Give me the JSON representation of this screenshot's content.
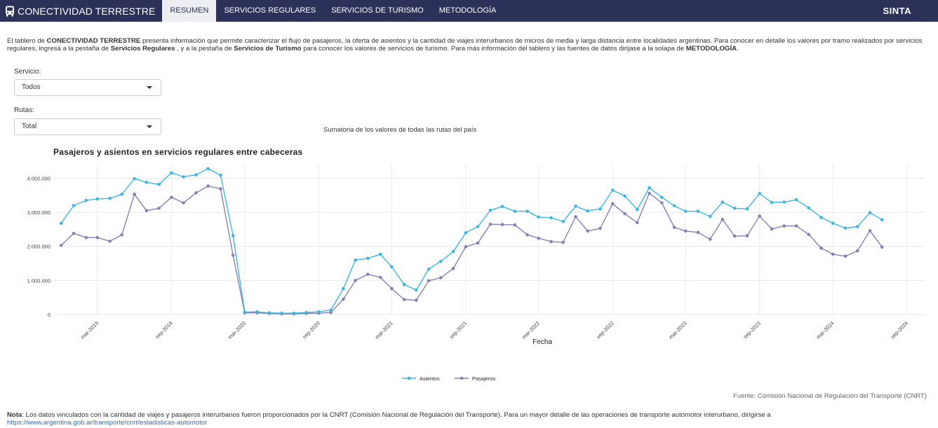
{
  "navbar": {
    "brand": "CONECTIVIDAD TERRESTRE",
    "brand_icon": "bus-icon",
    "tabs": [
      {
        "label": "RESUMEN",
        "active": true
      },
      {
        "label": "SERVICIOS REGULARES",
        "active": false
      },
      {
        "label": "SERVICIOS DE TURISMO",
        "active": false
      },
      {
        "label": "METODOLOGÍA",
        "active": false
      }
    ],
    "right_brand": "SINTA",
    "bg_color": "#2c3159"
  },
  "intro": {
    "t1": "El tablero de ",
    "b1": "CONECTIVIDAD TERRESTRE",
    "t2": " presenta información que permite caracterizar el flujo de pasajeros, la oferta de asientos y la cantidad de viajes interurbanos de micros de media y larga distancia entre localidades argentinas. Para conocer en detalle los valores por tramo realizados por servicios regulares, ingresá a la pestaña de ",
    "b2": "Servicios Regulares",
    "t3": " , y a la pestaña de ",
    "b3": "Servicios de Turismo",
    "t4": " para conocer los valores de servicios de turismo. Para más información del tablero y las fuentes de datos dirijase a la solapa de ",
    "b4": "METODOLOGÍA",
    "t5": "."
  },
  "filters": {
    "servicio_label": "Servicio:",
    "servicio_value": "Todos",
    "rutas_label": "Rutas:",
    "rutas_value": "Total"
  },
  "chart_subtitle": "Sumatoria de los valores de todas las rutas del país",
  "chart_data": {
    "type": "line",
    "title": "Pasajeros y asientos en servicios regulares entre cabeceras",
    "xlabel": "Fecha",
    "ylabel": "",
    "x": [
      "2018-12",
      "2019-01",
      "2019-02",
      "2019-03",
      "2019-04",
      "2019-05",
      "2019-06",
      "2019-07",
      "2019-08",
      "2019-09",
      "2019-10",
      "2019-11",
      "2019-12",
      "2020-01",
      "2020-02",
      "2020-03",
      "2020-04",
      "2020-05",
      "2020-06",
      "2020-07",
      "2020-08",
      "2020-09",
      "2020-10",
      "2020-11",
      "2020-12",
      "2021-01",
      "2021-02",
      "2021-03",
      "2021-04",
      "2021-05",
      "2021-06",
      "2021-07",
      "2021-08",
      "2021-09",
      "2021-10",
      "2021-11",
      "2021-12",
      "2022-01",
      "2022-02",
      "2022-03",
      "2022-04",
      "2022-05",
      "2022-06",
      "2022-07",
      "2022-08",
      "2022-09",
      "2022-10",
      "2022-11",
      "2022-12",
      "2023-01",
      "2023-02",
      "2023-03",
      "2023-04",
      "2023-05",
      "2023-06",
      "2023-07",
      "2023-08",
      "2023-09",
      "2023-10",
      "2023-11",
      "2023-12",
      "2024-01",
      "2024-02",
      "2024-03",
      "2024-04",
      "2024-05",
      "2024-06",
      "2024-07",
      "2024-08"
    ],
    "x_ticks": [
      "mar-2019",
      "sep-2019",
      "mar-2020",
      "sep-2020",
      "mar-2021",
      "sep-2021",
      "mar-2022",
      "sep-2022",
      "mar-2023",
      "sep-2023",
      "mar-2024",
      "sep-2024"
    ],
    "x_tick_dates": [
      "2019-03",
      "2019-09",
      "2020-03",
      "2020-09",
      "2021-03",
      "2021-09",
      "2022-03",
      "2022-09",
      "2023-03",
      "2023-09",
      "2024-03",
      "2024-09"
    ],
    "y_ticks": [
      "0",
      "1.000.000",
      "2.000.000",
      "3.000.000",
      "4.000.000"
    ],
    "ylim": [
      0,
      4400000
    ],
    "x_range": [
      "2018-11-15",
      "2024-10-15"
    ],
    "grid": true,
    "legend_position": "bottom-center",
    "series": [
      {
        "name": "Asientos",
        "color": "#3fb6e2",
        "values": [
          2680000,
          3200000,
          3350000,
          3390000,
          3410000,
          3530000,
          3990000,
          3880000,
          3820000,
          4160000,
          4040000,
          4100000,
          4280000,
          4090000,
          2320000,
          70000,
          80000,
          50000,
          40000,
          40000,
          60000,
          80000,
          130000,
          760000,
          1600000,
          1650000,
          1770000,
          1400000,
          880000,
          720000,
          1330000,
          1560000,
          1850000,
          2400000,
          2580000,
          3060000,
          3170000,
          3030000,
          3030000,
          2860000,
          2840000,
          2730000,
          3180000,
          3040000,
          3100000,
          3650000,
          3480000,
          3080000,
          3720000,
          3440000,
          3190000,
          3030000,
          3030000,
          2880000,
          3300000,
          3120000,
          3100000,
          3550000,
          3290000,
          3300000,
          3370000,
          3130000,
          2850000,
          2680000,
          2540000,
          2580000,
          2990000,
          2780000
        ]
      },
      {
        "name": "Pasajeros",
        "color": "#8a7fb5",
        "values": [
          2030000,
          2380000,
          2260000,
          2260000,
          2150000,
          2340000,
          3530000,
          3050000,
          3120000,
          3440000,
          3280000,
          3570000,
          3770000,
          3690000,
          1740000,
          50000,
          50000,
          30000,
          20000,
          20000,
          30000,
          40000,
          60000,
          450000,
          1000000,
          1180000,
          1090000,
          760000,
          440000,
          420000,
          990000,
          1080000,
          1350000,
          1990000,
          2100000,
          2650000,
          2640000,
          2630000,
          2340000,
          2240000,
          2140000,
          2120000,
          2870000,
          2450000,
          2530000,
          3250000,
          2960000,
          2700000,
          3560000,
          3280000,
          2560000,
          2450000,
          2410000,
          2210000,
          2790000,
          2300000,
          2310000,
          2890000,
          2510000,
          2600000,
          2600000,
          2350000,
          1950000,
          1770000,
          1710000,
          1870000,
          2460000,
          1980000
        ]
      }
    ]
  },
  "source": "Fuente: Comisión Nacional de Regulación del Transporte (CNRT)",
  "note": {
    "label": "Nota",
    "text": ": Los datos vinculados con la cantidad de viajes y pasajeros interurbanos fueron proporcionados por la CNRT (Comisión Nacional de Regulación del Transporte). Para un mayor detalle de las operaciones de transporte automotor interurbano, dirigirse a ",
    "link": "https://www.argentina.gob.ar/transporte/cnrt/estadisticas-automotor"
  }
}
